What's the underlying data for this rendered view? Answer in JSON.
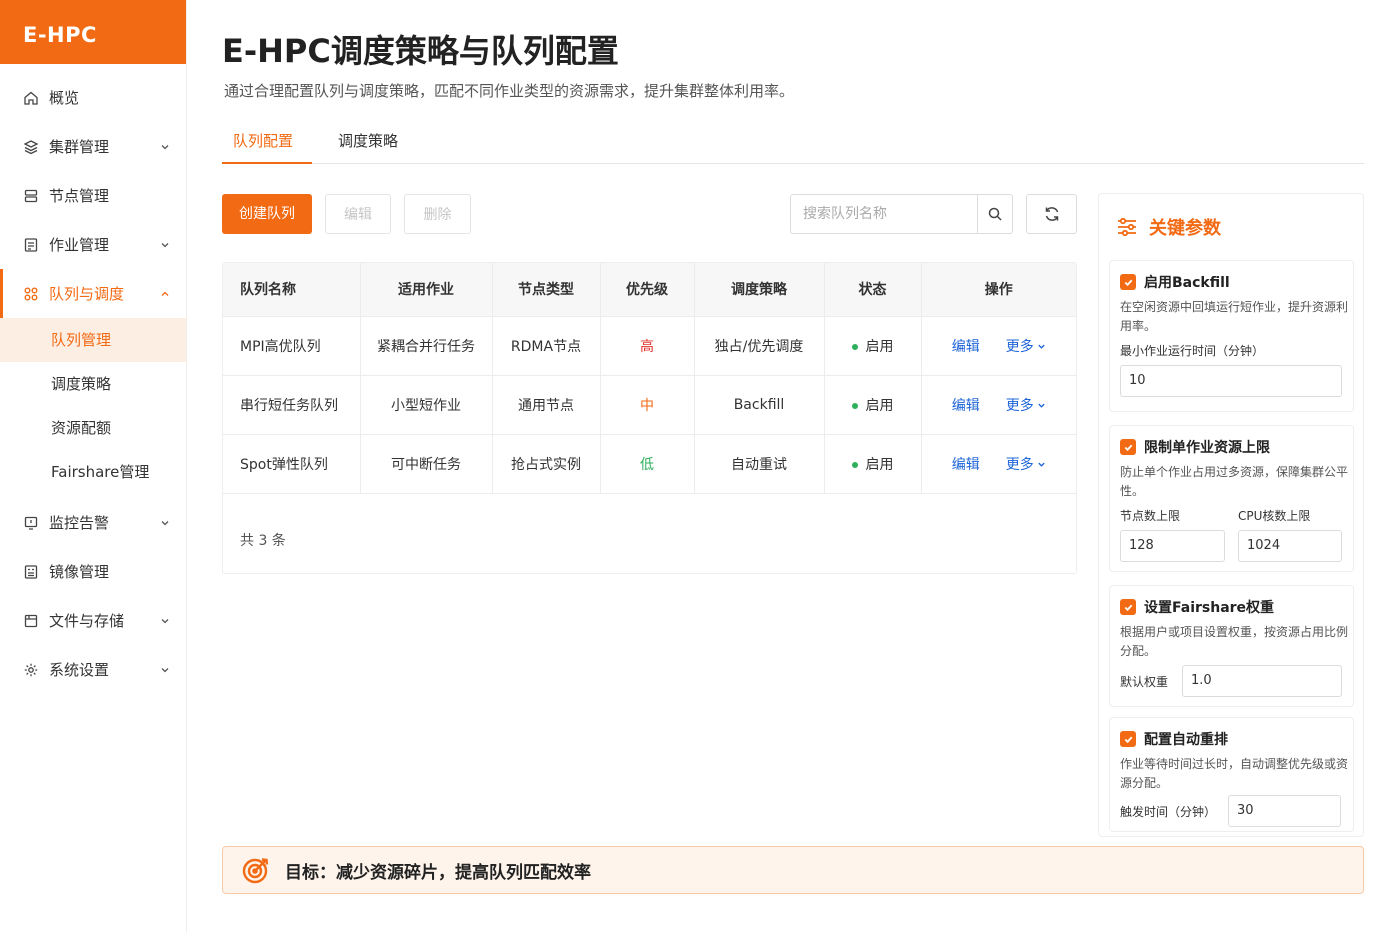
{
  "brand": "E-HPC",
  "colors": {
    "accent": "#f26a13",
    "link": "#1d64d8",
    "status_on": "#2eb05a",
    "prio_high": "#e0312a",
    "prio_mid": "#f26a13",
    "prio_low": "#2eb05a"
  },
  "sidebar": {
    "items": [
      {
        "label": "概览",
        "icon": "home-icon"
      },
      {
        "label": "集群管理",
        "icon": "layers-icon"
      },
      {
        "label": "节点管理",
        "icon": "server-icon"
      },
      {
        "label": "作业管理",
        "icon": "list-icon"
      },
      {
        "label": "队列与调度",
        "icon": "grid-icon"
      },
      {
        "label": "监控告警",
        "icon": "monitor-icon"
      },
      {
        "label": "镜像管理",
        "icon": "image-icon"
      },
      {
        "label": "文件与存储",
        "icon": "folder-icon"
      },
      {
        "label": "系统设置",
        "icon": "gear-icon"
      }
    ],
    "sub_items": [
      "队列管理",
      "调度策略",
      "资源配额",
      "Fairshare管理"
    ]
  },
  "header": {
    "title": "E-HPC调度策略与队列配置",
    "desc": "通过合理配置队列与调度策略，匹配不同作业类型的资源需求，提升集群整体利用率。"
  },
  "tabs": [
    "队列配置",
    "调度策略"
  ],
  "toolbar": {
    "create_label": "创建队列",
    "edit_label": "编辑",
    "delete_label": "删除",
    "search_placeholder": "搜索队列名称"
  },
  "table": {
    "columns": [
      "队列名称",
      "适用作业",
      "节点类型",
      "优先级",
      "调度策略",
      "状态",
      "操作"
    ],
    "rows": [
      {
        "name": "MPI高优队列",
        "job": "紧耦合并行任务",
        "node": "RDMA节点",
        "priority": "高",
        "policy": "独占/优先调度",
        "status": "启用",
        "edit": "编辑",
        "more": "更多"
      },
      {
        "name": "串行短任务队列",
        "job": "小型短作业",
        "node": "通用节点",
        "priority": "中",
        "policy": "Backfill",
        "status": "启用",
        "edit": "编辑",
        "more": "更多"
      },
      {
        "name": "Spot弹性队列",
        "job": "可中断任务",
        "node": "抢占式实例",
        "priority": "低",
        "policy": "自动重试",
        "status": "启用",
        "edit": "编辑",
        "more": "更多"
      }
    ],
    "total": "共 3 条"
  },
  "panel": {
    "title": "关键参数",
    "cards": [
      {
        "title": "启用Backfill",
        "desc": "在空闲资源中回填运行短作业，提升资源利用率。",
        "field_label": "最小作业运行时间（分钟）",
        "value": "10"
      },
      {
        "title": "限制单作业资源上限",
        "desc": "防止单个作业占用过多资源，保障集群公平性。",
        "field_label_1": "节点数上限",
        "value_1": "128",
        "field_label_2": "CPU核数上限",
        "value_2": "1024"
      },
      {
        "title": "设置Fairshare权重",
        "desc": "根据用户或项目设置权重，按资源占用比例分配。",
        "field_label": "默认权重",
        "value": "1.0"
      },
      {
        "title": "配置自动重排",
        "desc": "作业等待时间过长时，自动调整优先级或资源分配。",
        "field_label": "触发时间（分钟）",
        "value": "30"
      }
    ]
  },
  "goal": "目标：减少资源碎片，提高队列匹配效率"
}
